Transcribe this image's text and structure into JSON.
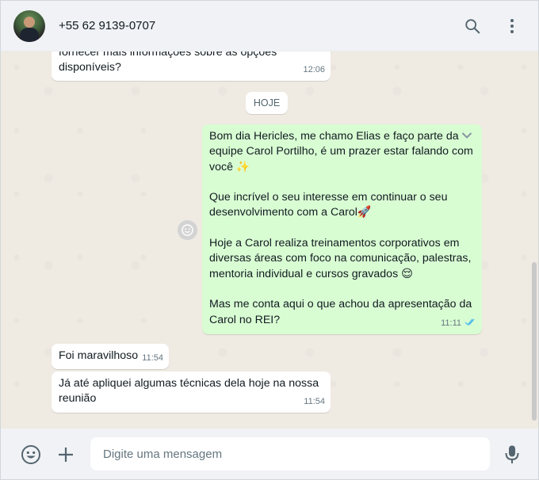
{
  "header": {
    "contact_name": "+55 62 9139-0707",
    "icons": [
      "search-icon",
      "menu-dots-icon"
    ]
  },
  "chat": {
    "date_separator": "HOJE",
    "messages": [
      {
        "direction": "in",
        "text": "fornecer mais informações sobre as opções\ndisponíveis?",
        "time": "12:06"
      },
      {
        "direction": "out",
        "text": "Bom dia Hericles, me chamo Elias e faço parte da equipe Carol Portilho, é um prazer estar falando com você ✨\n\nQue incrível o seu interesse em continuar o seu desenvolvimento com a Carol🚀\n\nHoje a Carol realiza treinamentos corporativos em diversas áreas com foco na comunicação, palestras, mentoria individual e cursos gravados 😌\n\nMas me conta aqui o que achou da apresentação da Carol no REI?",
        "time": "11:11",
        "status": "read"
      },
      {
        "direction": "in",
        "text": "Foi maravilhoso",
        "time": "11:54"
      },
      {
        "direction": "in",
        "text": "Já até apliquei algumas técnicas dela hoje na nossa\nreunião",
        "time": "11:54"
      }
    ]
  },
  "footer": {
    "placeholder": "Digite uma mensagem",
    "icons": [
      "emoji-icon",
      "plus-icon",
      "microphone-icon"
    ]
  },
  "colors": {
    "outgoing_bubble": "#d9fdd3",
    "incoming_bubble": "#ffffff",
    "chat_background": "#efeae2",
    "read_ticks": "#53bdeb"
  }
}
